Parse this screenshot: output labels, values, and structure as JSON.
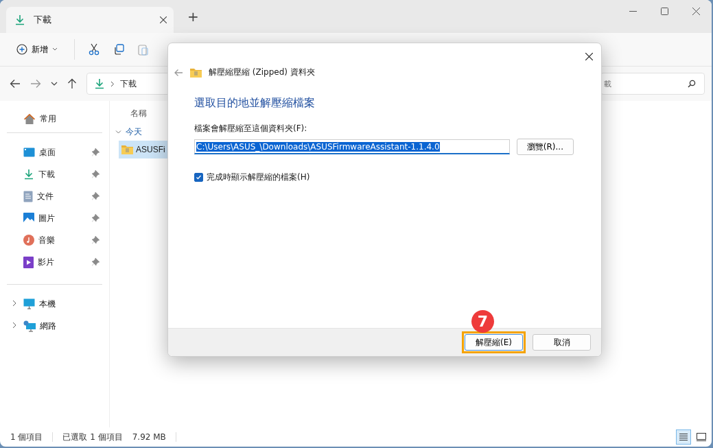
{
  "tab": {
    "title": "下載",
    "selected": true
  },
  "new_tab": "+",
  "toolbar": {
    "new_button": "新增"
  },
  "address": {
    "path": "下載"
  },
  "search": {
    "placeholder": "載"
  },
  "sidebar": {
    "sections": [
      [
        {
          "kind": "home",
          "label": "常用",
          "pinned": false
        }
      ],
      [
        {
          "kind": "desktop",
          "label": "桌面",
          "pinned": true
        },
        {
          "kind": "downloads",
          "label": "下載",
          "pinned": true
        },
        {
          "kind": "documents",
          "label": "文件",
          "pinned": true
        },
        {
          "kind": "pictures",
          "label": "圖片",
          "pinned": true
        },
        {
          "kind": "music",
          "label": "音樂",
          "pinned": true
        },
        {
          "kind": "videos",
          "label": "影片",
          "pinned": true
        }
      ],
      [
        {
          "kind": "pc",
          "label": "本機",
          "expanded": false
        },
        {
          "kind": "network",
          "label": "網路",
          "expanded": false
        }
      ]
    ]
  },
  "file_list": {
    "columns": [
      "名稱"
    ],
    "groups": [
      {
        "label": "今天",
        "expanded": true,
        "items": [
          {
            "name": "ASUSFi",
            "selected": true
          }
        ]
      }
    ]
  },
  "status_bar": {
    "item_count": "1 個項目",
    "selection": "已選取 1 個項目",
    "size": "7.92 MB"
  },
  "view_buttons": [
    {
      "kind": "details",
      "selected": true
    },
    {
      "kind": "tiles",
      "selected": false
    }
  ],
  "dialog": {
    "title": "解壓縮壓縮 (Zipped) 資料夾",
    "heading": "選取目的地並解壓縮檔案",
    "field_label": "檔案會解壓縮至這個資料夾(F):",
    "path": "C:\\Users\\ASUS_\\Downloads\\ASUSFirmwareAssistant-1.1.4.0",
    "path_selected": true,
    "browse": "瀏覽(R)...",
    "checkbox": {
      "label": "完成時顯示解壓縮的檔案(H)",
      "checked": true
    },
    "buttons": [
      {
        "label": "解壓縮(E)",
        "highlighted": true
      },
      {
        "label": "取消",
        "highlighted": false
      }
    ]
  },
  "step_badge": "7"
}
